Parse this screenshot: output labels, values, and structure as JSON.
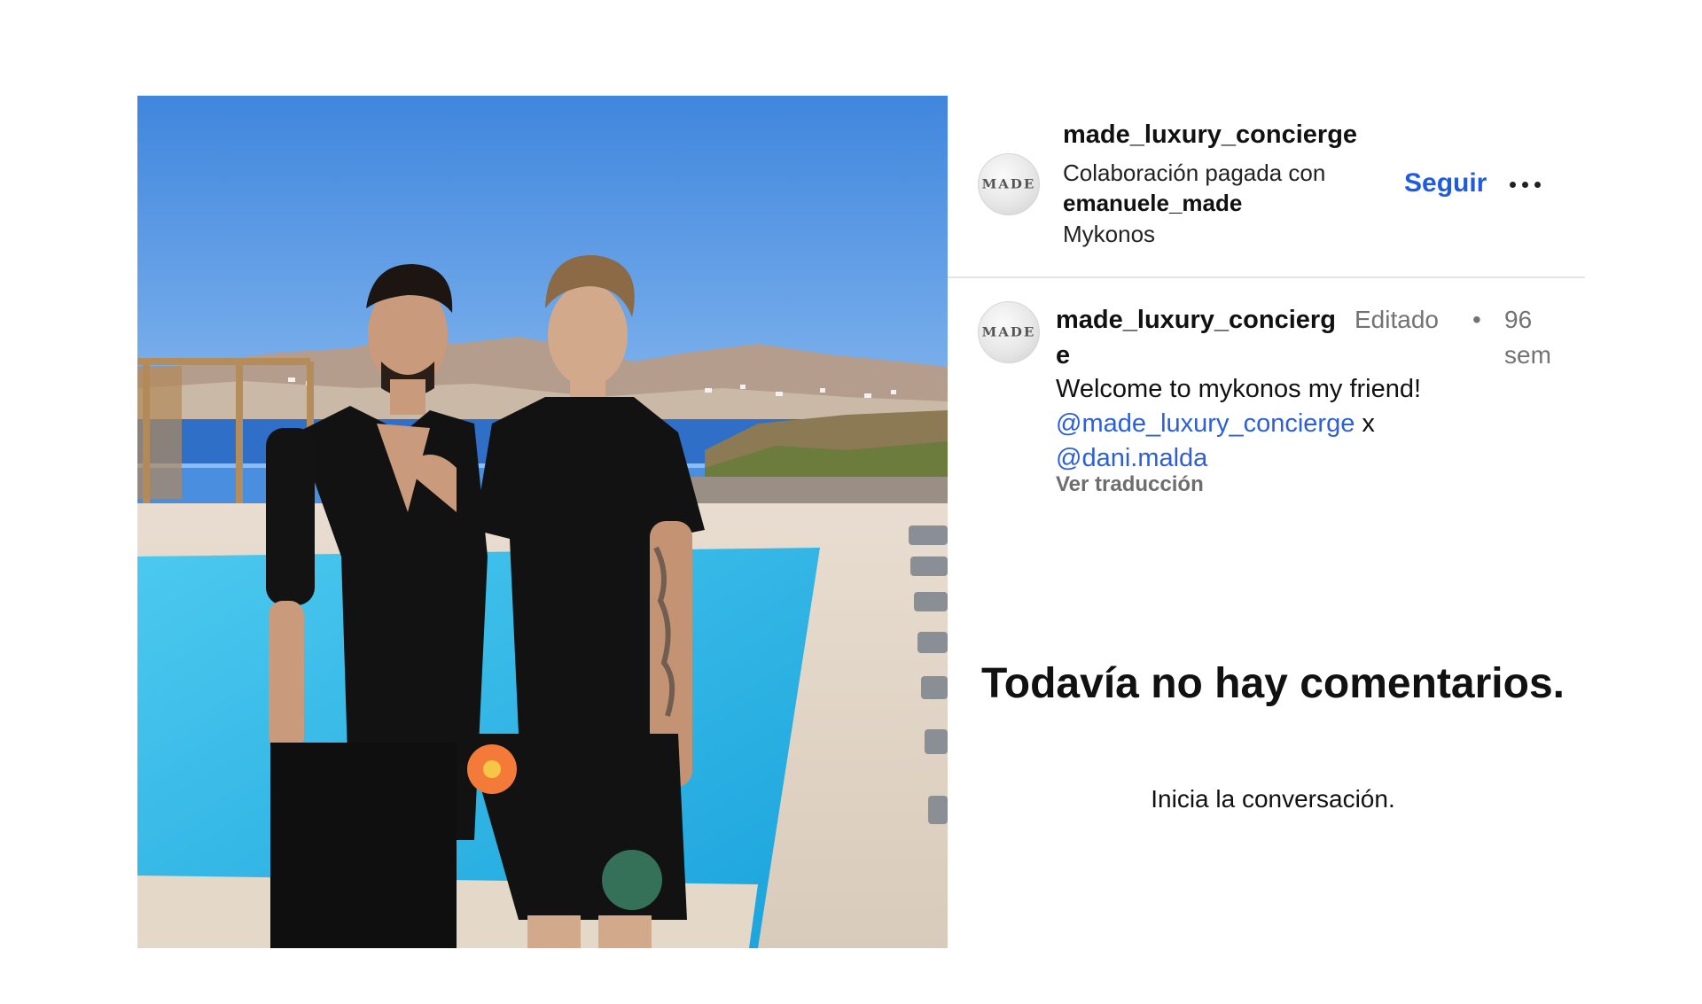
{
  "post": {
    "image_alt": "two men standing by a swimming pool in Mykonos"
  },
  "header": {
    "username": "made_luxury_concierge",
    "avatar_mark": "MADE",
    "collab_text": "Colaboración pagada con",
    "partner": "emanuele_made",
    "location": "Mykonos",
    "follow_label": "Seguir",
    "more_icon": "more-horizontal-icon"
  },
  "caption": {
    "username": "made_luxury_concierge",
    "edited": "Editado",
    "separator": "•",
    "time": "96 sem",
    "text": "Welcome to mykonos my friend!",
    "mention_1": "@made_luxury_concierge",
    "joiner": "x",
    "mention_2": "@dani.malda",
    "translate_label": "Ver traducción"
  },
  "comments": {
    "empty_title": "Todavía no hay comentarios.",
    "empty_subtitle": "Inicia la conversación."
  },
  "colors": {
    "link": "#1f5be0",
    "muted": "#737373",
    "divider": "#e3e3e3"
  }
}
